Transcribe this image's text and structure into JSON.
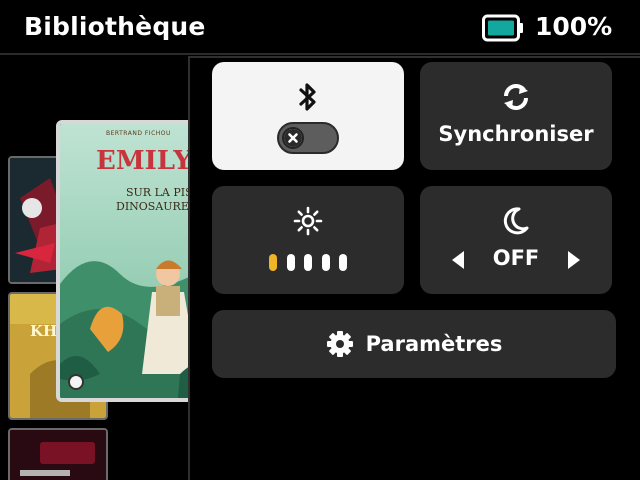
{
  "header": {
    "title": "Bibliothèque",
    "battery_percent": "100%",
    "battery_level": 1.0
  },
  "library": {
    "featured_cover": {
      "author": "BERTRAND FICHOU",
      "title_line1": "EMILY JO",
      "subtitle_line1": "SUR LA PISTE",
      "subtitle_line2": "DINOSAURES DIS"
    },
    "side_cover_2_text": "KHE"
  },
  "quick_panel": {
    "bluetooth": {
      "enabled": false
    },
    "sync": {
      "label": "Synchroniser"
    },
    "brightness": {
      "level": 1,
      "max": 5
    },
    "night_mode": {
      "value": "OFF"
    },
    "settings": {
      "label": "Paramètres"
    }
  },
  "colors": {
    "accent": "#f0b429",
    "tile_dark": "#2c2c2c",
    "tile_light": "#f4f4f4",
    "battery": "#12a8a0"
  }
}
